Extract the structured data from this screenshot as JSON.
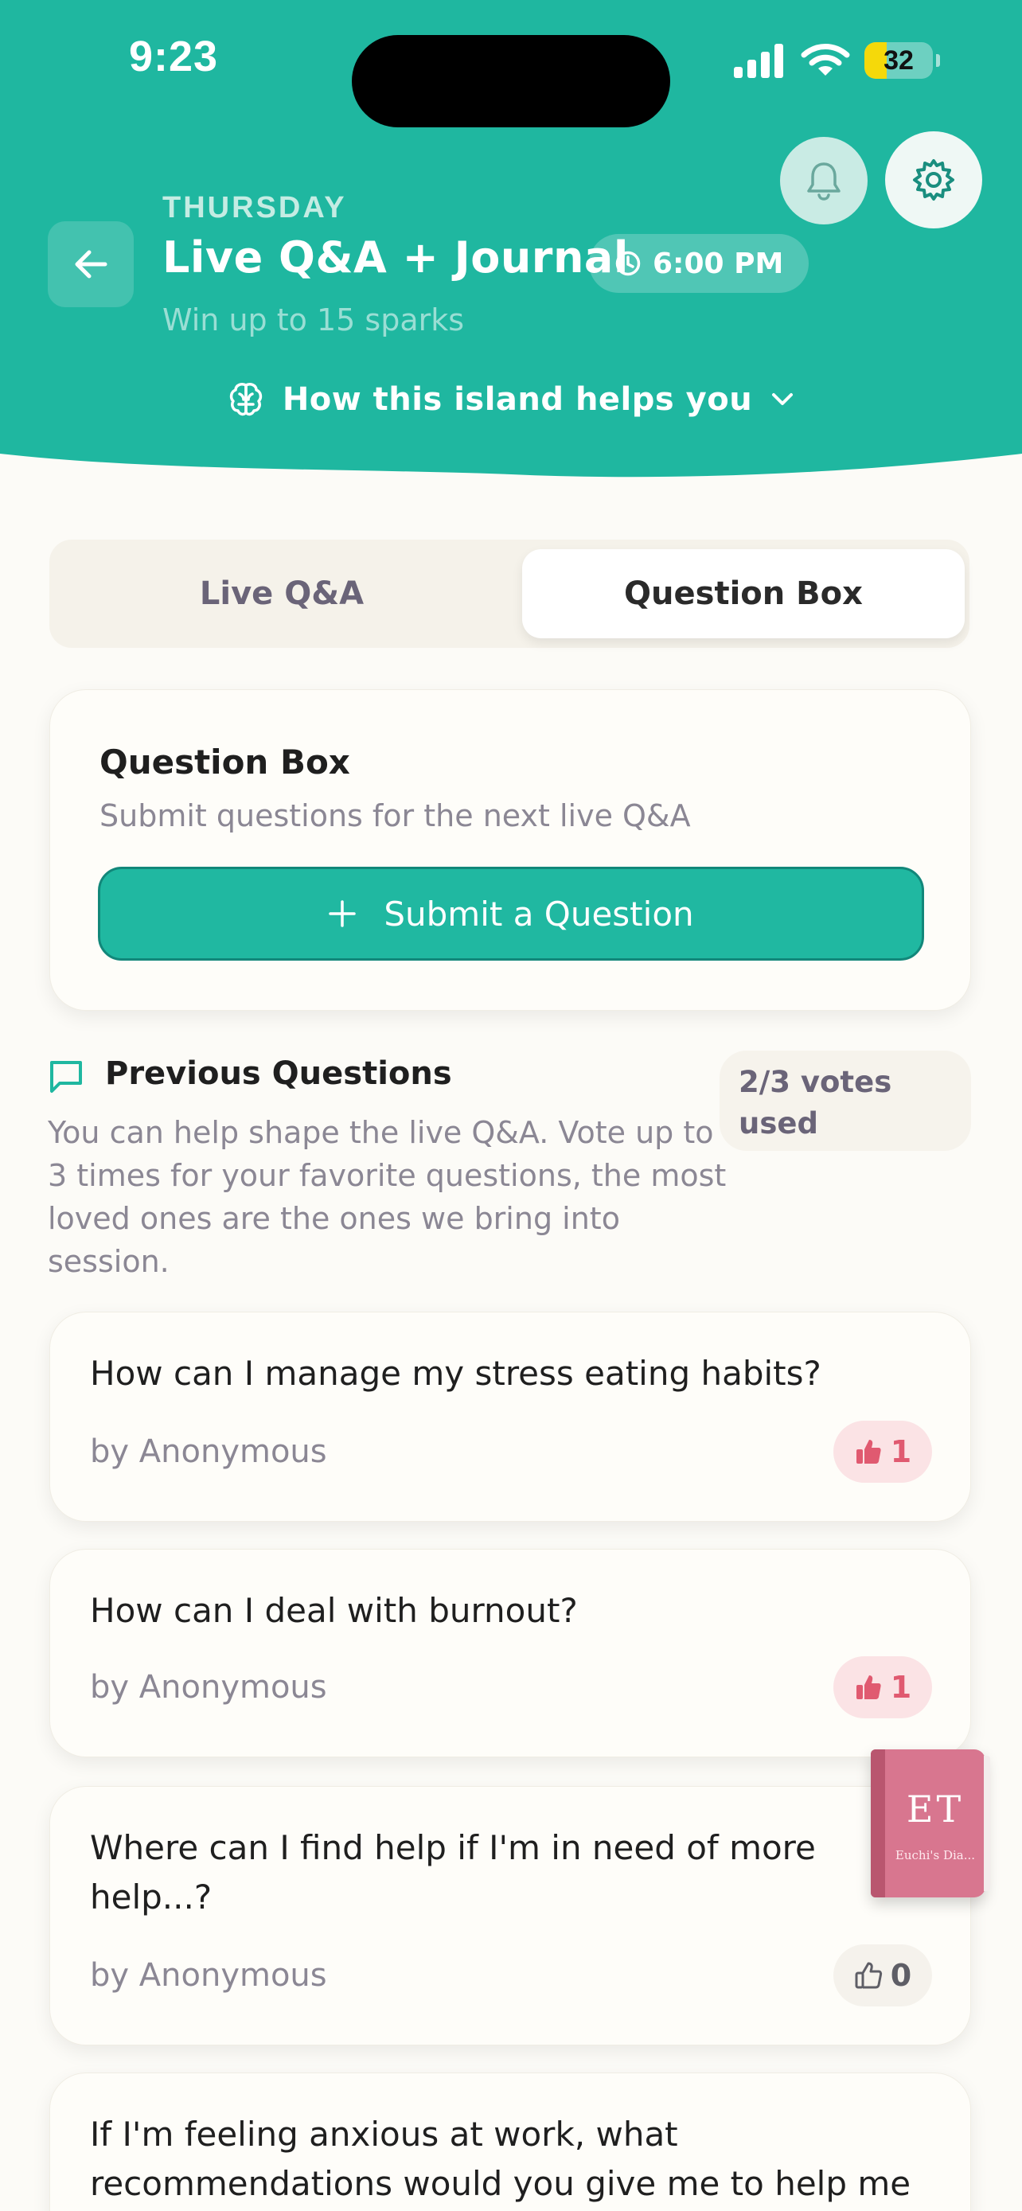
{
  "status_bar": {
    "time": "9:23",
    "battery": "32",
    "battery_level": 0.32
  },
  "header": {
    "day": "THURSDAY",
    "title": "Live Q&A + Journal",
    "time": "6:00 PM",
    "subtitle": "Win up to 15 sparks",
    "helps_label": "How this island helps you"
  },
  "tabs": [
    {
      "label": "Live Q&A",
      "selected": false
    },
    {
      "label": "Question Box",
      "selected": true
    }
  ],
  "question_box": {
    "title": "Question Box",
    "subtitle": "Submit questions for the next live Q&A",
    "submit_label": "Submit a Question"
  },
  "previous": {
    "title": "Previous Questions",
    "description": "You can help shape the live Q&A. Vote up to 3 times for your favorite questions, the most loved ones are the ones we bring into session.",
    "votes_used": "2/3 votes used"
  },
  "questions": [
    {
      "text": "How can I manage my stress eating habits?",
      "author": "by Anonymous",
      "votes": "1",
      "voted": true
    },
    {
      "text": "How can I deal with burnout?",
      "author": "by Anonymous",
      "votes": "1",
      "voted": true
    },
    {
      "text": "Where can I find help if I'm in need of more help...?",
      "author": "by Anonymous",
      "votes": "0",
      "voted": false
    },
    {
      "text": "If I'm feeling anxious at work, what recommendations would you give me to help me",
      "author": "",
      "votes": "",
      "voted": false
    }
  ],
  "diary": {
    "monogram": "ET",
    "name": "Euchi's Dia..."
  },
  "colors": {
    "brand": "#20b8a1",
    "vote_active": "#e05a70",
    "background": "#fcfbf7"
  }
}
